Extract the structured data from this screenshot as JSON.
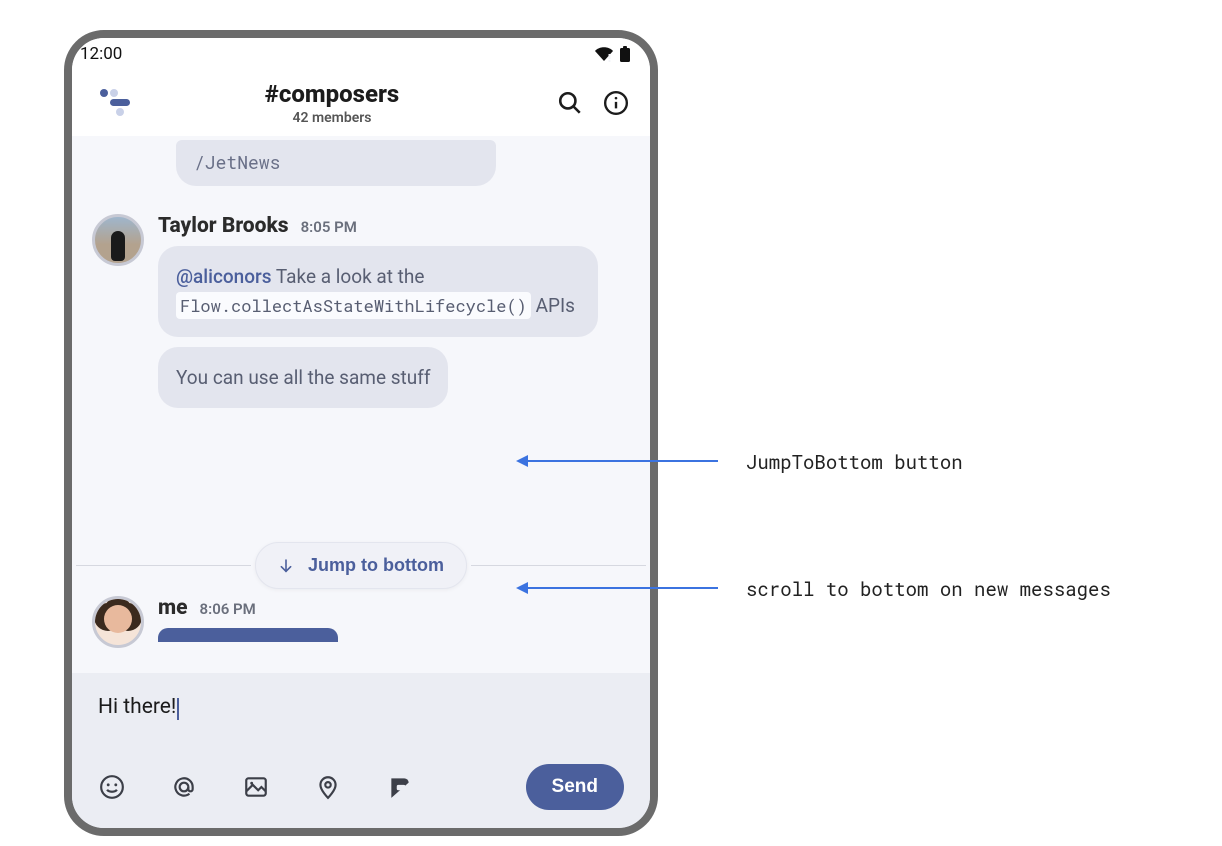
{
  "status": {
    "time": "12:00"
  },
  "appbar": {
    "channel": "#composers",
    "members": "42 members"
  },
  "prev_message": {
    "text": "/JetNews"
  },
  "taylor": {
    "author": "Taylor Brooks",
    "time": "8:05 PM",
    "msg1_mention": "@aliconors",
    "msg1_before": " Take a look at the ",
    "msg1_code": "Flow.collectAsStateWithLifecycle()",
    "msg1_after": " APIs",
    "msg2": "You can use all the same stuff"
  },
  "jump": {
    "label": "Jump to bottom"
  },
  "me_row": {
    "author": "me",
    "time": "8:06 PM"
  },
  "composer": {
    "value": "Hi there!",
    "send": "Send"
  },
  "annotations": {
    "a1": "JumpToBottom button",
    "a2": "scroll to bottom on new messages"
  }
}
